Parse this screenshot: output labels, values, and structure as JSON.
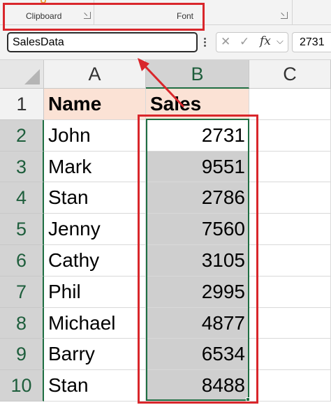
{
  "ribbon": {
    "groups": [
      {
        "label": "Clipboard"
      },
      {
        "label": "Font"
      }
    ]
  },
  "formula_bar": {
    "name_box": "SalesData",
    "formula_value": "2731",
    "fx_label": "fx",
    "cancel_glyph": "✕",
    "enter_glyph": "✓",
    "dropdown_glyph": "⌵"
  },
  "columns": [
    "A",
    "B",
    "C"
  ],
  "rows": [
    "1",
    "2",
    "3",
    "4",
    "5",
    "6",
    "7",
    "8",
    "9",
    "10"
  ],
  "table": {
    "headers": [
      "Name",
      "Sales"
    ],
    "data": [
      [
        "John",
        "2731"
      ],
      [
        "Mark",
        "9551"
      ],
      [
        "Stan",
        "2786"
      ],
      [
        "Jenny",
        "7560"
      ],
      [
        "Cathy",
        "3105"
      ],
      [
        "Phil",
        "2995"
      ],
      [
        "Michael",
        "4877"
      ],
      [
        "Barry",
        "6534"
      ],
      [
        "Stan",
        "8488"
      ]
    ]
  },
  "colors": {
    "highlight_red": "#d9262b",
    "selection_green": "#1e6e42",
    "header_fill": "#fbe2d5",
    "selected_fill": "#cfcfcf"
  }
}
